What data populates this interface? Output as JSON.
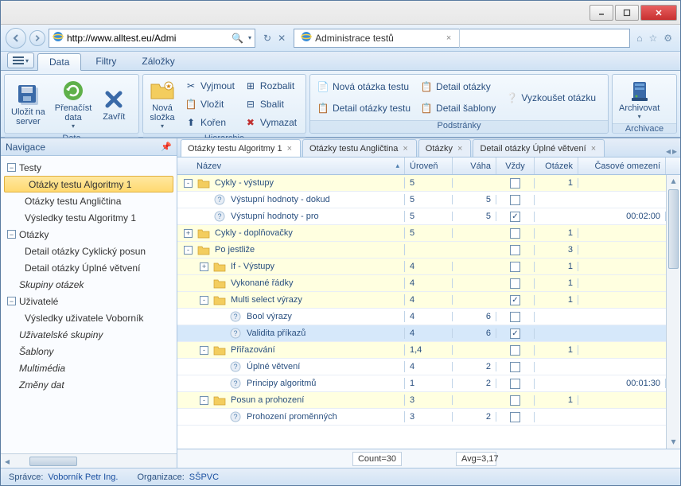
{
  "window": {
    "title": "Administrace testů"
  },
  "address": {
    "url": "http://www.alltest.eu/Admi"
  },
  "menuTabs": {
    "data": "Data",
    "filtry": "Filtry",
    "zalozky": "Záložky"
  },
  "ribbon": {
    "groups": {
      "data": {
        "label": "Data",
        "save": "Uložit na\nserver",
        "reload": "Přenačíst\ndata",
        "close": "Zavřít"
      },
      "hierarchie": {
        "label": "Hierarchie",
        "newFolder": "Nová\nsložka",
        "cut": "Vyjmout",
        "paste": "Vložit",
        "root": "Kořen",
        "expand": "Rozbalit",
        "collapse": "Sbalit",
        "delete": "Vymazat"
      },
      "podstranky": {
        "label": "Podstránky",
        "newQ": "Nová otázka testu",
        "detailQT": "Detail otázky testu",
        "detailQ": "Detail otázky",
        "detailT": "Detail šablony",
        "tryQ": "Vyzkoušet otázku"
      },
      "archivace": {
        "label": "Archivace",
        "archive": "Archivovat"
      }
    }
  },
  "nav": {
    "title": "Navigace",
    "items": [
      {
        "type": "cat",
        "label": "Testy",
        "open": true
      },
      {
        "type": "sub",
        "label": "Otázky testu Algoritmy 1",
        "sel": true
      },
      {
        "type": "sub",
        "label": "Otázky testu Angličtina"
      },
      {
        "type": "sub",
        "label": "Výsledky testu Algoritmy 1"
      },
      {
        "type": "cat",
        "label": "Otázky",
        "open": true
      },
      {
        "type": "sub",
        "label": "Detail otázky Cyklický posun"
      },
      {
        "type": "sub",
        "label": "Detail otázky Úplné větvení"
      },
      {
        "type": "cat",
        "label": "Skupiny otázek",
        "italic": true,
        "leaf": true
      },
      {
        "type": "cat",
        "label": "Uživatelé",
        "open": true
      },
      {
        "type": "sub",
        "label": "Výsledky uživatele Voborník"
      },
      {
        "type": "cat",
        "label": "Uživatelské skupiny",
        "italic": true,
        "leaf": true
      },
      {
        "type": "cat",
        "label": "Šablony",
        "italic": true,
        "leaf": true
      },
      {
        "type": "cat",
        "label": "Multimédia",
        "italic": true,
        "leaf": true
      },
      {
        "type": "cat",
        "label": "Změny dat",
        "italic": true,
        "leaf": true
      }
    ]
  },
  "tabs": [
    {
      "label": "Otázky testu Algoritmy 1",
      "active": true,
      "closable": true
    },
    {
      "label": "Otázky testu Angličtina",
      "closable": true
    },
    {
      "label": "Otázky",
      "closable": true
    },
    {
      "label": "Detail otázky Úplné větvení",
      "closable": true
    }
  ],
  "grid": {
    "headers": {
      "name": "Název",
      "level": "Úroveň",
      "weight": "Váha",
      "always": "Vždy",
      "questions": "Otázek",
      "time": "Časové omezení"
    },
    "rows": [
      {
        "folder": true,
        "depth": 0,
        "toggle": "-",
        "name": "Cykly - výstupy",
        "level": "5",
        "weight": "",
        "always": false,
        "q": "1",
        "time": ""
      },
      {
        "folder": false,
        "depth": 1,
        "name": "Výstupní hodnoty - dokud",
        "level": "5",
        "weight": "5",
        "always": false,
        "q": "",
        "time": ""
      },
      {
        "folder": false,
        "depth": 1,
        "name": "Výstupní hodnoty - pro",
        "level": "5",
        "weight": "5",
        "always": true,
        "q": "",
        "time": "00:02:00"
      },
      {
        "folder": true,
        "depth": 0,
        "toggle": "+",
        "name": "Cykly - doplňovačky",
        "level": "5",
        "weight": "",
        "always": false,
        "q": "1",
        "time": ""
      },
      {
        "folder": true,
        "depth": 0,
        "toggle": "-",
        "name": "Po jestliže",
        "level": "",
        "weight": "",
        "always": false,
        "q": "3",
        "time": ""
      },
      {
        "folder": true,
        "depth": 1,
        "toggle": "+",
        "name": "If - Výstupy",
        "level": "4",
        "weight": "",
        "always": false,
        "q": "1",
        "time": ""
      },
      {
        "folder": true,
        "depth": 1,
        "toggle": "",
        "name": "Vykonané řádky",
        "level": "4",
        "weight": "",
        "always": false,
        "q": "1",
        "time": ""
      },
      {
        "folder": true,
        "depth": 1,
        "toggle": "-",
        "name": "Multi select výrazy",
        "level": "4",
        "weight": "",
        "always": true,
        "q": "1",
        "time": ""
      },
      {
        "folder": false,
        "depth": 2,
        "name": "Bool výrazy",
        "level": "4",
        "weight": "6",
        "always": false,
        "q": "",
        "time": ""
      },
      {
        "folder": false,
        "depth": 2,
        "name": "Validita příkazů",
        "level": "4",
        "weight": "6",
        "always": true,
        "q": "",
        "time": "",
        "sel": true
      },
      {
        "folder": true,
        "depth": 1,
        "toggle": "-",
        "name": "Přiřazování",
        "level": "1,4",
        "weight": "",
        "always": false,
        "q": "1",
        "time": ""
      },
      {
        "folder": false,
        "depth": 2,
        "name": "Úplné větvení",
        "level": "4",
        "weight": "2",
        "always": false,
        "q": "",
        "time": ""
      },
      {
        "folder": false,
        "depth": 2,
        "name": "Principy algoritmů",
        "level": "1",
        "weight": "2",
        "always": false,
        "q": "",
        "time": "00:01:30"
      },
      {
        "folder": true,
        "depth": 1,
        "toggle": "-",
        "name": "Posun a prohození",
        "level": "3",
        "weight": "",
        "always": false,
        "q": "1",
        "time": ""
      },
      {
        "folder": false,
        "depth": 2,
        "name": "Prohození proměnných",
        "level": "3",
        "weight": "2",
        "always": false,
        "q": "",
        "time": ""
      }
    ],
    "footer": {
      "count": "Count=30",
      "avg": "Avg=3,17"
    }
  },
  "status": {
    "adminLabel": "Správce:",
    "adminName": "Voborník Petr Ing.",
    "orgLabel": "Organizace:",
    "orgName": "SŠPVC"
  }
}
